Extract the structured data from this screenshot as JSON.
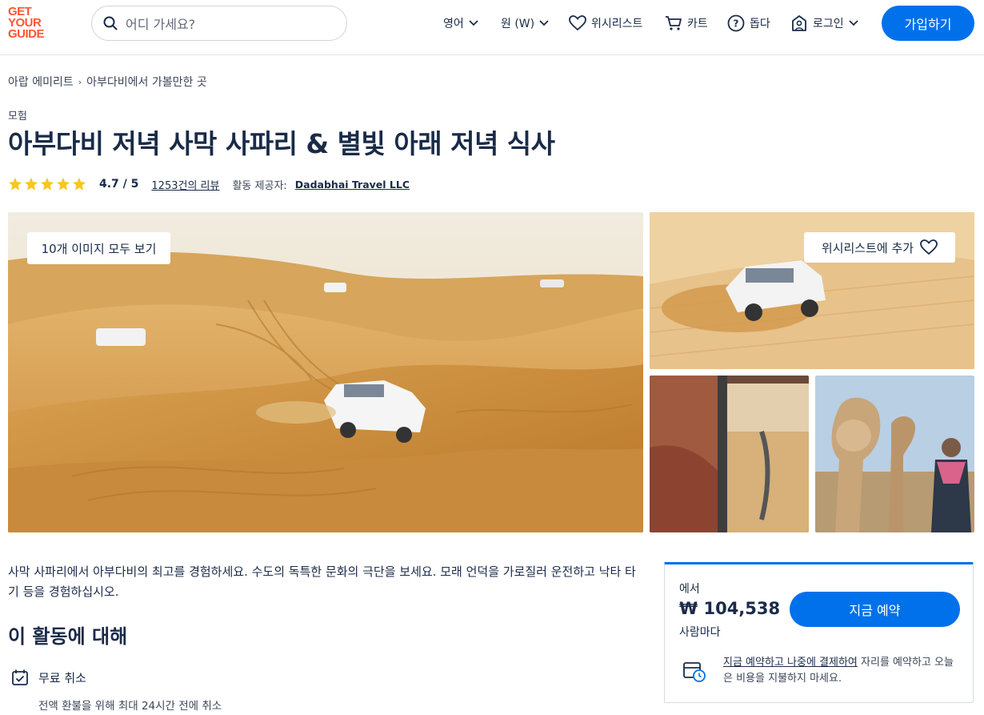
{
  "header": {
    "logo": [
      "GET",
      "YOUR",
      "GUIDE"
    ],
    "search_placeholder": "어디 가세요?",
    "language": "영어",
    "currency": "원 (W)",
    "wishlist": "위시리스트",
    "cart": "카트",
    "help": "돕다",
    "login": "로그인",
    "signup": "가입하기"
  },
  "breadcrumb": [
    "아랍 에미리트",
    "아부다비에서 가볼만한 곳"
  ],
  "category": "모험",
  "title": "아부다비 저녁 사막 사파리 & 별빛 아래 저녁 식사",
  "rating": {
    "stars": 5,
    "value": "4.7 / 5",
    "reviews": "1253건의 리뷰",
    "provider_label": "활동 제공자:",
    "provider": "Dadabhai Travel LLC"
  },
  "gallery": {
    "view_all": "10개 이미지 모두 보기",
    "add_wishlist": "위시리스트에 추가"
  },
  "description": "사막 사파리에서 아부다비의 최고를 경험하세요. 수도의 독특한 문화의 극단을 보세요. 모래 언덕을 가로질러 운전하고 낙타 타기 등을 경험하십시오.",
  "about": {
    "heading": "이 활동에 대해",
    "feature_label": "무료 취소",
    "feature_sub": "전액 환불을 위해 최대 24시간 전에 취소"
  },
  "booking": {
    "from": "에서",
    "price": "₩ 104,538",
    "per": "사람마다",
    "button": "지금 예약",
    "note_link": "지금 예약하고 나중에 결제하여",
    "note_rest": " 자리를 예약하고 오늘은 비용을 지불하지 마세요."
  },
  "colors": {
    "brand": "#ff5533",
    "primary": "#0071eb",
    "text": "#1a2b49",
    "star": "#f8c71c"
  }
}
